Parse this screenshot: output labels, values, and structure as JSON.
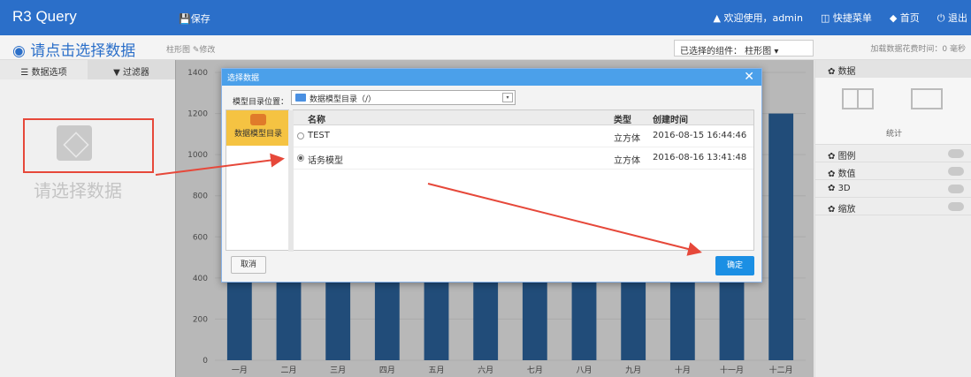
{
  "topbar": {
    "brand": "R3 Query",
    "save": "💾保存",
    "welcome": "▲ 欢迎使用，admin",
    "quick_menu": "◫ 快捷菜单",
    "home": "◆ 首页",
    "logout": "⏻ 退出"
  },
  "page": {
    "title": "请点击选择数据",
    "meta": "柱形图 ✎修改",
    "component": "已选择的组件：  柱形图   ▾",
    "load_time": "加载数据花费时间：0 毫秒"
  },
  "left_panel": {
    "tabs": [
      {
        "label": "数据选项"
      },
      {
        "label": "过滤器"
      }
    ],
    "placeholder": "请选择数据"
  },
  "chart_data": {
    "type": "bar",
    "categories": [
      "一月",
      "二月",
      "三月",
      "四月",
      "五月",
      "六月",
      "七月",
      "八月",
      "九月",
      "十月",
      "十一月",
      "十二月"
    ],
    "series": [
      {
        "values": [
          1000,
          1000,
          1000,
          1000,
          1000,
          1000,
          1000,
          1000,
          1000,
          1000,
          1000,
          1200
        ]
      }
    ],
    "y_ticks": [
      0,
      200,
      400,
      600,
      800,
      1000,
      1200,
      1400
    ],
    "ylim": [
      0,
      1400
    ],
    "bar_color": "#2e6aa8"
  },
  "right_panel": {
    "header": "数据",
    "widget_label": "统计",
    "options": [
      {
        "label": "图例"
      },
      {
        "label": "数值"
      },
      {
        "label": "3D"
      },
      {
        "label": "缩放"
      }
    ]
  },
  "modal": {
    "title": "选择数据",
    "close": "✕",
    "location_label": "模型目录位置：",
    "location_value": "数据模型目录（/）",
    "tree_label": "数据模型目录",
    "columns": {
      "name": "名称",
      "type": "类型",
      "created": "创建时间"
    },
    "rows": [
      {
        "name": "TEST",
        "type": "立方体",
        "created": "2016-08-15 16:44:46"
      },
      {
        "name": "话务模型",
        "type": "立方体",
        "created": "2016-08-16 13:41:48"
      }
    ],
    "cancel": "取消",
    "confirm": "确定"
  },
  "colors": {
    "accent": "#2b6fc9",
    "annotation": "#e6483a",
    "modal_header": "#4ba0ea",
    "confirm": "#1b8fe4"
  }
}
